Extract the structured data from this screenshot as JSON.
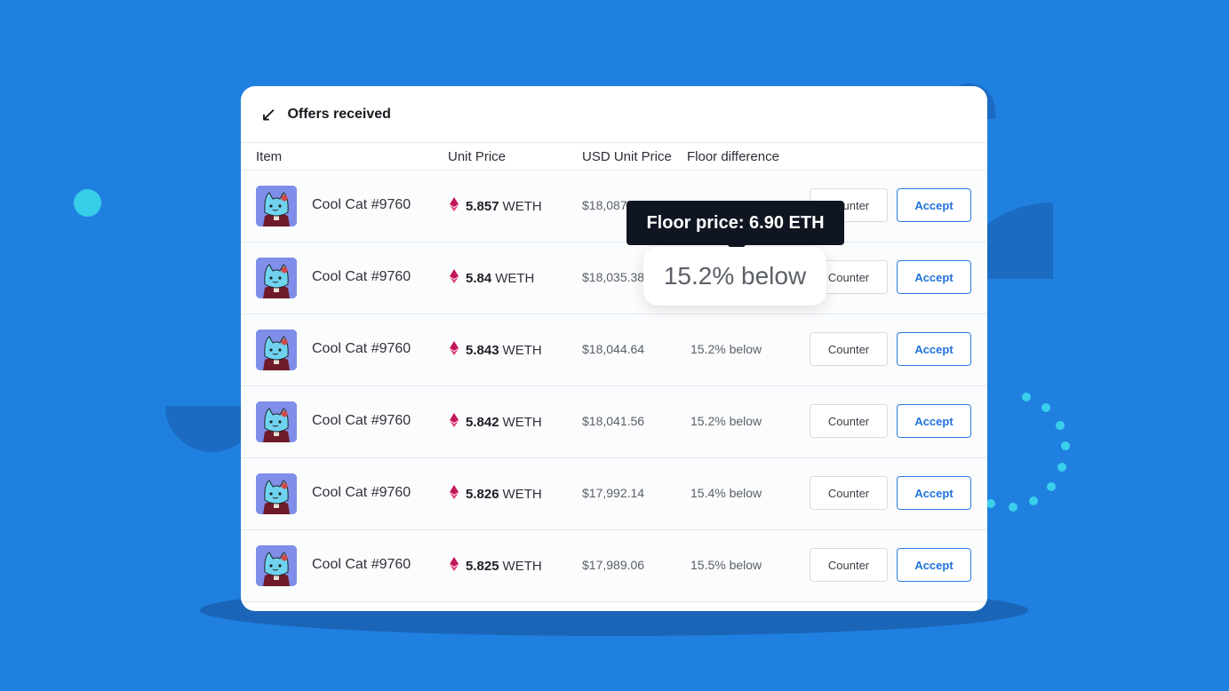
{
  "panel": {
    "title": "Offers received"
  },
  "columns": {
    "item": "Item",
    "unit_price": "Unit Price",
    "usd_unit_price": "USD Unit Price",
    "floor_difference": "Floor difference"
  },
  "rows": [
    {
      "name": "Cool Cat #9760",
      "price": "5.857",
      "currency": "WETH",
      "usd": "$18,087",
      "floor": ""
    },
    {
      "name": "Cool Cat #9760",
      "price": "5.84",
      "currency": "WETH",
      "usd": "$18,035.38",
      "floor": ""
    },
    {
      "name": "Cool Cat #9760",
      "price": "5.843",
      "currency": "WETH",
      "usd": "$18,044.64",
      "floor": "15.2% below"
    },
    {
      "name": "Cool Cat #9760",
      "price": "5.842",
      "currency": "WETH",
      "usd": "$18,041.56",
      "floor": "15.2% below"
    },
    {
      "name": "Cool Cat #9760",
      "price": "5.826",
      "currency": "WETH",
      "usd": "$17,992.14",
      "floor": "15.4% below"
    },
    {
      "name": "Cool Cat #9760",
      "price": "5.825",
      "currency": "WETH",
      "usd": "$17,989.06",
      "floor": "15.5% below"
    }
  ],
  "buttons": {
    "counter": "Counter",
    "accept": "Accept"
  },
  "tooltip": {
    "text": "Floor price: 6.90 ETH"
  },
  "zoom_callout": {
    "text": "15.2% below"
  },
  "icons": {
    "header": "arrow-down-left-icon",
    "currency": "ethereum-icon"
  },
  "colors": {
    "background": "#2080e0",
    "accent": "#2272d8",
    "eth_icon": "#c2185b",
    "tooltip": "#0f1521"
  }
}
